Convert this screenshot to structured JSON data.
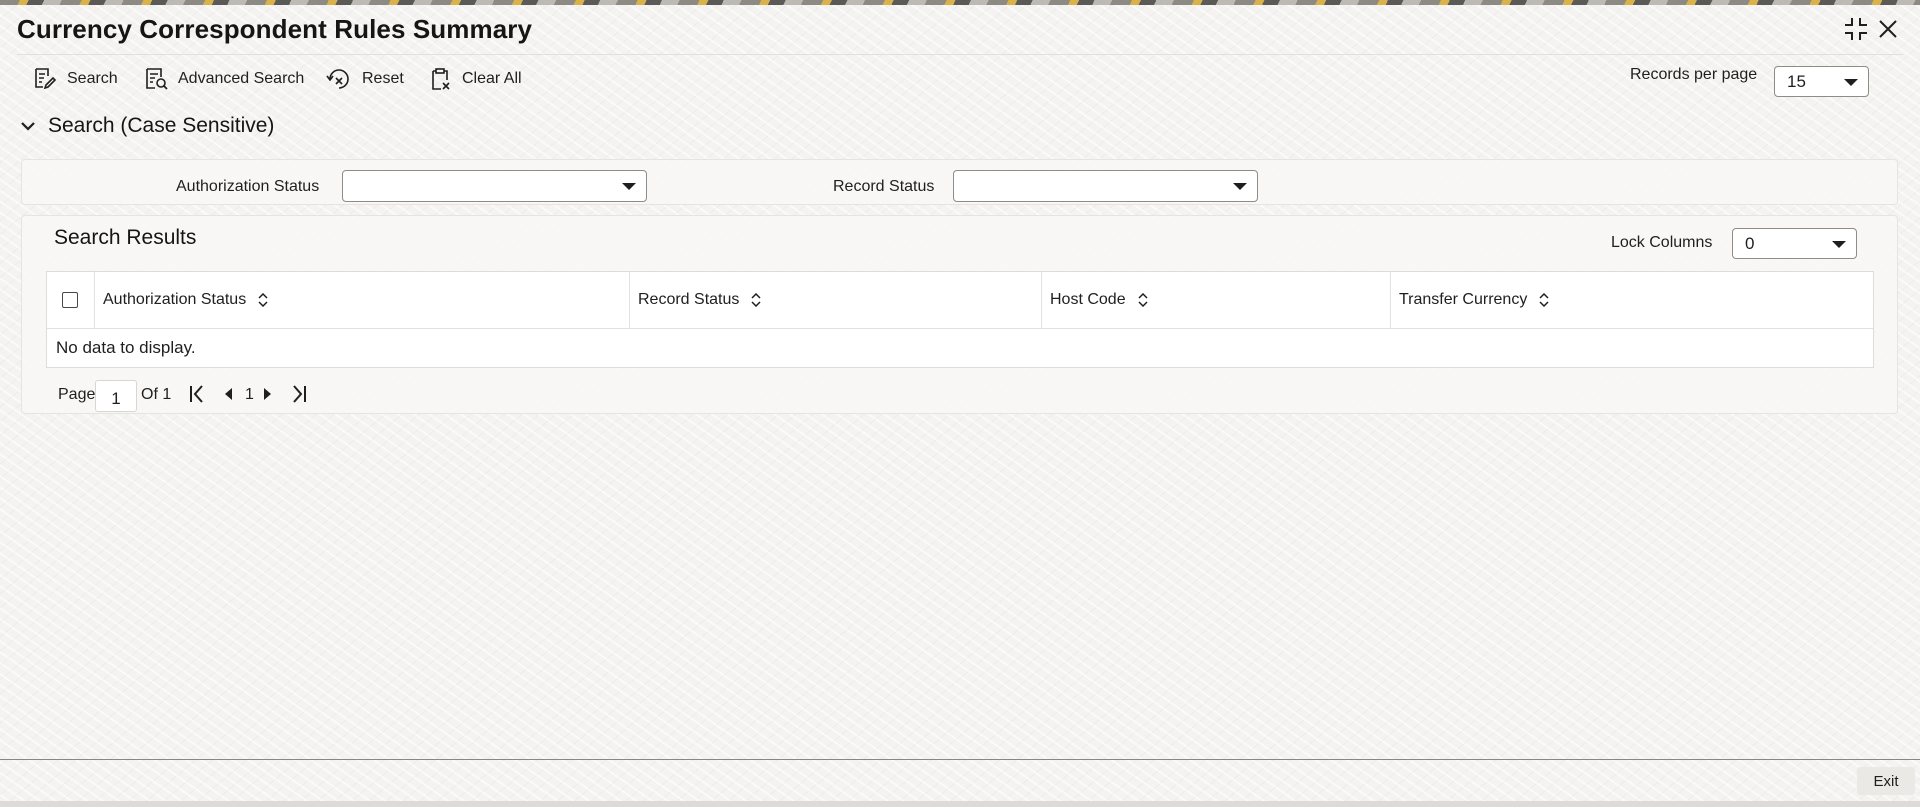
{
  "window": {
    "title": "Currency Correspondent Rules Summary"
  },
  "toolbar": {
    "search": "Search",
    "advanced_search": "Advanced Search",
    "reset": "Reset",
    "clear_all": "Clear All",
    "records_per_page_label": "Records per page",
    "records_per_page_value": "15"
  },
  "search_panel": {
    "title": "Search (Case Sensitive)",
    "authorization_status_label": "Authorization Status",
    "authorization_status_value": "",
    "record_status_label": "Record Status",
    "record_status_value": ""
  },
  "results": {
    "title": "Search Results",
    "lock_columns_label": "Lock Columns",
    "lock_columns_value": "0",
    "columns": [
      "Authorization Status",
      "Record Status",
      "Host Code",
      "Transfer Currency"
    ],
    "empty_message": "No data to display."
  },
  "pagination": {
    "page_label": "Page",
    "current_page": "1",
    "of_label": "Of 1",
    "page_number": "1"
  },
  "footer": {
    "exit": "Exit"
  },
  "colors": {
    "text": "#1f1f1f",
    "panel_bg": "#f8f7f6",
    "border": "#8f8c87"
  }
}
